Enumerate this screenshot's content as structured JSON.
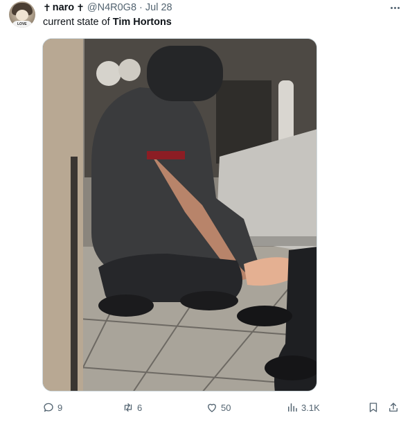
{
  "tweet": {
    "cross_left": "✝",
    "display_name": "naro",
    "cross_right": "✝",
    "handle": "@N4R0G8",
    "separator": "·",
    "date": "Jul 28",
    "text_prefix": "current state of ",
    "text_bold": "Tim Hortons",
    "avatar_text": "LOVE"
  },
  "actions": {
    "replies": "9",
    "reposts": "6",
    "likes": "50",
    "views": "3.1K"
  },
  "icons": {
    "more": "more-horizontal-icon",
    "reply": "reply-icon",
    "repost": "repost-icon",
    "like": "heart-icon",
    "views": "views-chart-icon",
    "bookmark": "bookmark-icon",
    "share": "share-icon"
  },
  "colors": {
    "text": "#0f1419",
    "secondary": "#536471",
    "border": "#cfd9de"
  }
}
